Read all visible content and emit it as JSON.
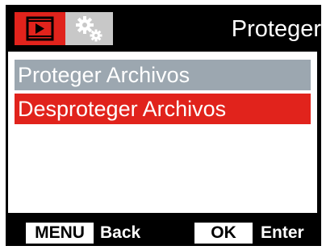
{
  "header": {
    "title": "Proteger",
    "tabs": [
      {
        "icon": "playback-icon",
        "active": true,
        "color": "#e1231c"
      },
      {
        "icon": "gears-icon",
        "active": false,
        "color": "#c8c8c8"
      }
    ]
  },
  "menu": {
    "items": [
      {
        "label": "Proteger Archivos",
        "highlighted": false,
        "color": "#9ca7b0"
      },
      {
        "label": "Desproteger Archivos",
        "highlighted": true,
        "color": "#e1231c"
      }
    ]
  },
  "footer": {
    "menu_key": "MENU",
    "menu_action": "Back",
    "ok_key": "OK",
    "ok_action": "Enter"
  }
}
